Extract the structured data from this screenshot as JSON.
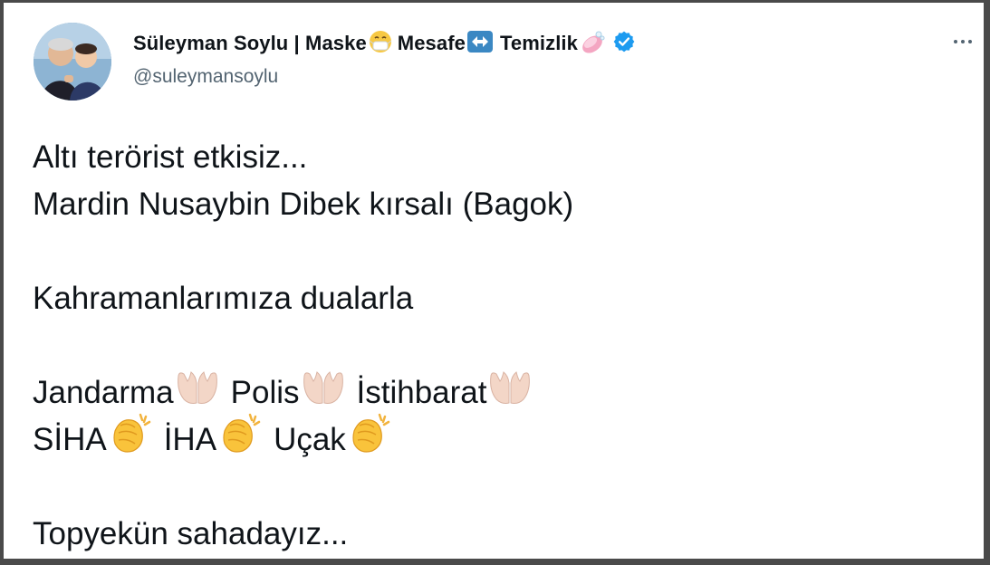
{
  "author": {
    "name": "Süleyman Soylu | Maske",
    "name_mid": "Mesafe",
    "name_end": "Temizlik",
    "name_emojis": [
      "mask-face-emoji",
      "left-right-arrow-emoji",
      "soap-emoji"
    ],
    "handle": "@suleymansoylu",
    "verified": true
  },
  "tweet": {
    "line1": "Altı terörist etkisiz...",
    "line2": "Mardin Nusaybin Dibek kırsalı (Bagok)",
    "line3": "Kahramanlarımıza dualarla",
    "line4_a": "Jandarma",
    "line4_b": "Polis",
    "line4_c": "İstihbarat",
    "line5_a": "SİHA",
    "line5_b": "İHA",
    "line5_c": "Uçak",
    "line6": "Topyekün sahadayız..."
  },
  "icons": {
    "more": "more-options-icon",
    "verified": "verified-badge-icon",
    "praying_hands": "palms-up-together-emoji",
    "clapping": "clapping-hands-emoji"
  },
  "colors": {
    "verified_blue": "#1d9bf0",
    "text_primary": "#0f1419",
    "text_secondary": "#536471"
  }
}
